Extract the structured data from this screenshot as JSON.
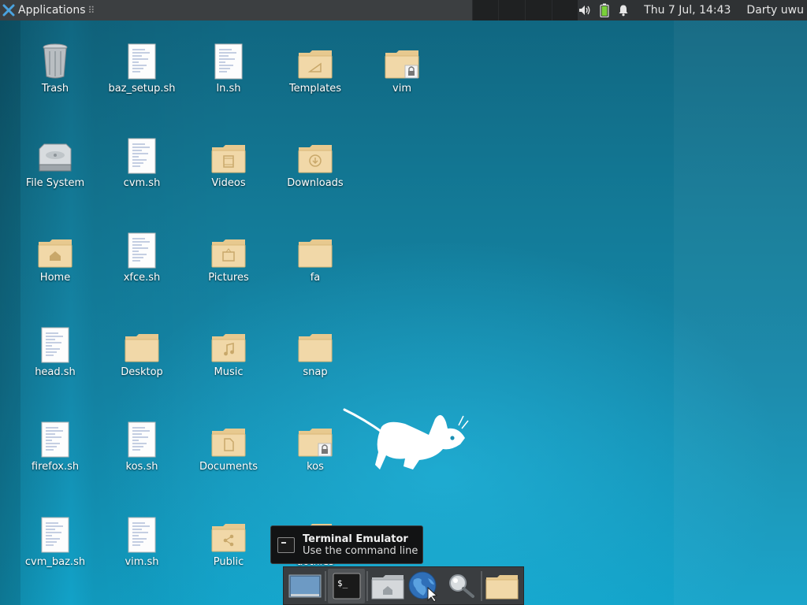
{
  "panel": {
    "apps_label": "Applications",
    "apps_dots": "⠿",
    "clock": "Thu  7 Jul, 14:43",
    "user": "Darty uwu"
  },
  "desktop": {
    "icons": [
      {
        "label": "Trash",
        "kind": "trash-icon"
      },
      {
        "label": "baz_setup.sh",
        "kind": "script-file-icon"
      },
      {
        "label": "ln.sh",
        "kind": "script-file-icon"
      },
      {
        "label": "Templates",
        "kind": "templates-folder-icon"
      },
      {
        "label": "vim",
        "kind": "locked-folder-icon"
      },
      {
        "label": "File System",
        "kind": "hard-drive-icon"
      },
      {
        "label": "cvm.sh",
        "kind": "script-file-icon"
      },
      {
        "label": "Videos",
        "kind": "videos-folder-icon"
      },
      {
        "label": "Downloads",
        "kind": "downloads-folder-icon"
      },
      {
        "label": "Home",
        "kind": "home-folder-icon"
      },
      {
        "label": "xfce.sh",
        "kind": "script-file-icon"
      },
      {
        "label": "Pictures",
        "kind": "pictures-folder-icon"
      },
      {
        "label": "fa",
        "kind": "folder-icon"
      },
      {
        "label": "head.sh",
        "kind": "script-file-icon"
      },
      {
        "label": "Desktop",
        "kind": "folder-icon"
      },
      {
        "label": "Music",
        "kind": "music-folder-icon"
      },
      {
        "label": "snap",
        "kind": "folder-icon"
      },
      {
        "label": "firefox.sh",
        "kind": "script-file-icon"
      },
      {
        "label": "kos.sh",
        "kind": "script-file-icon"
      },
      {
        "label": "Documents",
        "kind": "documents-folder-icon"
      },
      {
        "label": "kos",
        "kind": "locked-folder-icon"
      },
      {
        "label": "cvm_baz.sh",
        "kind": "script-file-icon"
      },
      {
        "label": "vim.sh",
        "kind": "script-file-icon"
      },
      {
        "label": "Public",
        "kind": "public-folder-icon"
      },
      {
        "label": "dotfiles",
        "kind": "folder-icon"
      }
    ]
  },
  "tooltip": {
    "title": "Terminal Emulator",
    "subtitle": "Use the command line"
  },
  "dock": {
    "items": [
      "show-desktop-icon",
      "terminal-icon",
      "file-manager-icon",
      "web-browser-icon",
      "app-finder-icon",
      "folder-icon"
    ]
  },
  "colors": {
    "panel_bg": "#2f3234",
    "folder": "#f1d8a8",
    "desktop_blue": "#1489ab"
  }
}
